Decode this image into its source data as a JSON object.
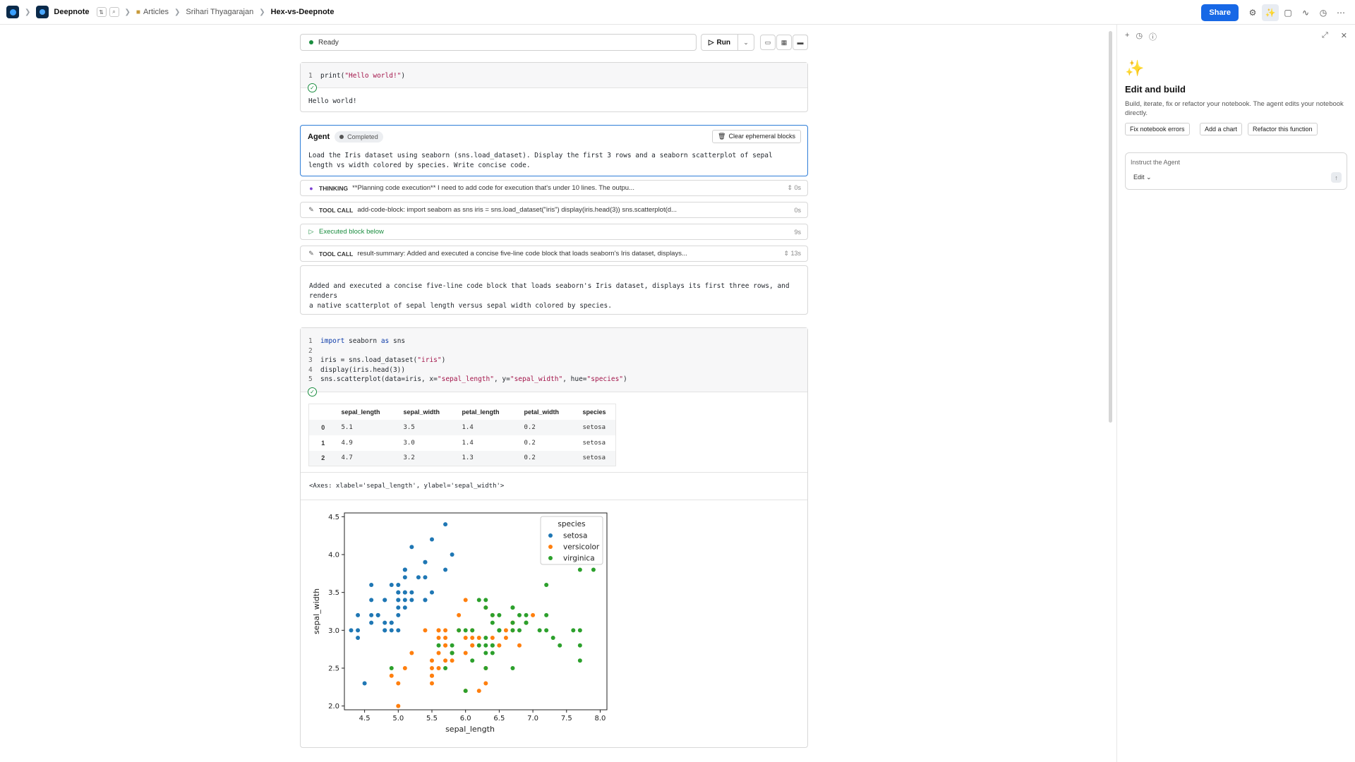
{
  "topbar": {
    "workspace": "Deepnote",
    "crumbs": [
      "Articles",
      "Srihari Thyagarajan"
    ],
    "current": "Hex-vs-Deepnote",
    "share": "Share",
    "icons": [
      "settings-icon",
      "agent-icon",
      "comment-icon",
      "activity-icon",
      "history-icon",
      "more-icon"
    ]
  },
  "status": {
    "text": "Ready",
    "run": "Run"
  },
  "cell1": {
    "code": [
      {
        "n": "1",
        "text": "print(\"Hello world!\")"
      }
    ],
    "output": "Hello world!"
  },
  "agent": {
    "title": "Agent",
    "status": "Completed",
    "clear": "Clear ephemeral blocks",
    "prompt_line1": "Load the Iris dataset using seaborn (sns.load_dataset). Display the first 3 rows and a seaborn scatterplot of sepal",
    "prompt_line2": "length vs width colored by species. Write concise code."
  },
  "steps": [
    {
      "label": "THINKING",
      "text": "**Planning code execution** I need to add code for execution that's under 10 lines. The outpu...",
      "time": "0s"
    },
    {
      "label": "TOOL CALL",
      "text": "add-code-block: import seaborn as sns iris = sns.load_dataset(\"iris\") display(iris.head(3)) sns.scatterplot(d...",
      "time": "0s"
    },
    {
      "label": "",
      "text": "Executed block below",
      "time": "9s"
    },
    {
      "label": "TOOL CALL",
      "text": "result-summary: Added and executed a concise five-line code block that loads seaborn's Iris dataset, displays...",
      "time": "13s"
    }
  ],
  "summary": {
    "line1": "Added and executed a concise five-line code block that loads seaborn's Iris dataset, displays its first three rows, and renders",
    "line2": "a native scatterplot of sepal length versus sepal width colored by species."
  },
  "cell2": {
    "code_lines": [
      "1",
      "2",
      "3",
      "4",
      "5"
    ],
    "table": {
      "columns": [
        "",
        "sepal_length",
        "sepal_width",
        "petal_length",
        "petal_width",
        "species"
      ],
      "rows": [
        [
          "0",
          "5.1",
          "3.5",
          "1.4",
          "0.2",
          "setosa"
        ],
        [
          "1",
          "4.9",
          "3.0",
          "1.4",
          "0.2",
          "setosa"
        ],
        [
          "2",
          "4.7",
          "3.2",
          "1.3",
          "0.2",
          "setosa"
        ]
      ]
    },
    "axes_repr": "<Axes: xlabel='sepal_length', ylabel='sepal_width'>"
  },
  "chart_data": {
    "type": "scatter",
    "xlabel": "sepal_length",
    "ylabel": "sepal_width",
    "xlim": [
      4.2,
      8.1
    ],
    "ylim": [
      1.95,
      4.55
    ],
    "xticks": [
      4.5,
      5.0,
      5.5,
      6.0,
      6.5,
      7.0,
      7.5,
      8.0
    ],
    "yticks": [
      2.0,
      2.5,
      3.0,
      3.5,
      4.0,
      4.5
    ],
    "legend_title": "species",
    "legend_position": "top-right",
    "series": [
      {
        "name": "setosa",
        "color": "#1f77b4",
        "points": [
          [
            5.1,
            3.5
          ],
          [
            4.9,
            3.0
          ],
          [
            4.7,
            3.2
          ],
          [
            4.6,
            3.1
          ],
          [
            5.0,
            3.6
          ],
          [
            5.4,
            3.9
          ],
          [
            4.6,
            3.4
          ],
          [
            5.0,
            3.4
          ],
          [
            4.4,
            2.9
          ],
          [
            4.9,
            3.1
          ],
          [
            5.4,
            3.7
          ],
          [
            4.8,
            3.4
          ],
          [
            4.8,
            3.0
          ],
          [
            4.3,
            3.0
          ],
          [
            5.8,
            4.0
          ],
          [
            5.7,
            4.4
          ],
          [
            5.4,
            3.9
          ],
          [
            5.1,
            3.5
          ],
          [
            5.7,
            3.8
          ],
          [
            5.1,
            3.8
          ],
          [
            5.4,
            3.4
          ],
          [
            5.1,
            3.7
          ],
          [
            4.6,
            3.6
          ],
          [
            5.1,
            3.3
          ],
          [
            4.8,
            3.4
          ],
          [
            5.0,
            3.0
          ],
          [
            5.0,
            3.4
          ],
          [
            5.2,
            3.5
          ],
          [
            5.2,
            3.4
          ],
          [
            4.7,
            3.2
          ],
          [
            4.8,
            3.1
          ],
          [
            5.4,
            3.4
          ],
          [
            5.2,
            4.1
          ],
          [
            5.5,
            4.2
          ],
          [
            4.9,
            3.1
          ],
          [
            5.0,
            3.2
          ],
          [
            5.5,
            3.5
          ],
          [
            4.9,
            3.6
          ],
          [
            4.4,
            3.0
          ],
          [
            5.1,
            3.4
          ],
          [
            5.0,
            3.5
          ],
          [
            4.5,
            2.3
          ],
          [
            4.4,
            3.2
          ],
          [
            5.0,
            3.5
          ],
          [
            5.1,
            3.8
          ],
          [
            4.8,
            3.0
          ],
          [
            5.1,
            3.8
          ],
          [
            4.6,
            3.2
          ],
          [
            5.3,
            3.7
          ],
          [
            5.0,
            3.3
          ]
        ]
      },
      {
        "name": "versicolor",
        "color": "#ff7f0e",
        "points": [
          [
            7.0,
            3.2
          ],
          [
            6.4,
            3.2
          ],
          [
            6.9,
            3.1
          ],
          [
            5.5,
            2.3
          ],
          [
            6.5,
            2.8
          ],
          [
            5.7,
            2.8
          ],
          [
            6.3,
            3.3
          ],
          [
            4.9,
            2.4
          ],
          [
            6.6,
            2.9
          ],
          [
            5.2,
            2.7
          ],
          [
            5.0,
            2.0
          ],
          [
            5.9,
            3.0
          ],
          [
            6.0,
            2.2
          ],
          [
            6.1,
            2.9
          ],
          [
            5.6,
            2.9
          ],
          [
            6.7,
            3.1
          ],
          [
            5.6,
            3.0
          ],
          [
            5.8,
            2.7
          ],
          [
            6.2,
            2.2
          ],
          [
            5.6,
            2.5
          ],
          [
            5.9,
            3.2
          ],
          [
            6.1,
            2.8
          ],
          [
            6.3,
            2.5
          ],
          [
            6.1,
            2.8
          ],
          [
            6.4,
            2.9
          ],
          [
            6.6,
            3.0
          ],
          [
            6.8,
            2.8
          ],
          [
            6.7,
            3.0
          ],
          [
            6.0,
            2.9
          ],
          [
            5.7,
            2.6
          ],
          [
            5.5,
            2.4
          ],
          [
            5.5,
            2.4
          ],
          [
            5.8,
            2.7
          ],
          [
            6.0,
            2.7
          ],
          [
            5.4,
            3.0
          ],
          [
            6.0,
            3.4
          ],
          [
            6.7,
            3.1
          ],
          [
            6.3,
            2.3
          ],
          [
            5.6,
            3.0
          ],
          [
            5.5,
            2.5
          ],
          [
            5.5,
            2.6
          ],
          [
            6.1,
            3.0
          ],
          [
            5.8,
            2.6
          ],
          [
            5.0,
            2.3
          ],
          [
            5.6,
            2.7
          ],
          [
            5.7,
            3.0
          ],
          [
            5.7,
            2.9
          ],
          [
            6.2,
            2.9
          ],
          [
            5.1,
            2.5
          ],
          [
            5.7,
            2.8
          ]
        ]
      },
      {
        "name": "virginica",
        "color": "#2ca02c",
        "points": [
          [
            6.3,
            3.3
          ],
          [
            5.8,
            2.7
          ],
          [
            7.1,
            3.0
          ],
          [
            6.3,
            2.9
          ],
          [
            6.5,
            3.0
          ],
          [
            7.6,
            3.0
          ],
          [
            4.9,
            2.5
          ],
          [
            7.3,
            2.9
          ],
          [
            6.7,
            2.5
          ],
          [
            7.2,
            3.6
          ],
          [
            6.5,
            3.2
          ],
          [
            6.4,
            2.7
          ],
          [
            6.8,
            3.0
          ],
          [
            5.7,
            2.5
          ],
          [
            5.8,
            2.8
          ],
          [
            6.4,
            3.2
          ],
          [
            6.5,
            3.0
          ],
          [
            7.7,
            3.8
          ],
          [
            7.7,
            2.6
          ],
          [
            6.0,
            2.2
          ],
          [
            6.9,
            3.2
          ],
          [
            5.6,
            2.8
          ],
          [
            7.7,
            2.8
          ],
          [
            6.3,
            2.7
          ],
          [
            6.7,
            3.3
          ],
          [
            7.2,
            3.2
          ],
          [
            6.2,
            2.8
          ],
          [
            6.1,
            3.0
          ],
          [
            6.4,
            2.8
          ],
          [
            7.2,
            3.0
          ],
          [
            7.4,
            2.8
          ],
          [
            7.9,
            3.8
          ],
          [
            6.4,
            2.8
          ],
          [
            6.3,
            2.8
          ],
          [
            6.1,
            2.6
          ],
          [
            7.7,
            3.0
          ],
          [
            6.3,
            3.4
          ],
          [
            6.4,
            3.1
          ],
          [
            6.0,
            3.0
          ],
          [
            6.9,
            3.1
          ],
          [
            6.7,
            3.1
          ],
          [
            6.9,
            3.1
          ],
          [
            5.8,
            2.7
          ],
          [
            6.8,
            3.2
          ],
          [
            6.7,
            3.3
          ],
          [
            6.7,
            3.0
          ],
          [
            6.3,
            2.5
          ],
          [
            6.5,
            3.0
          ],
          [
            6.2,
            3.4
          ],
          [
            5.9,
            3.0
          ]
        ]
      }
    ]
  },
  "panel": {
    "title": "Edit and build",
    "desc": "Build, iterate, fix or refactor your notebook. The agent edits your notebook directly.",
    "chips": [
      "Fix notebook errors",
      "Add a chart",
      "Refactor this function"
    ],
    "placeholder": "Instruct the Agent",
    "mode": "Edit"
  }
}
